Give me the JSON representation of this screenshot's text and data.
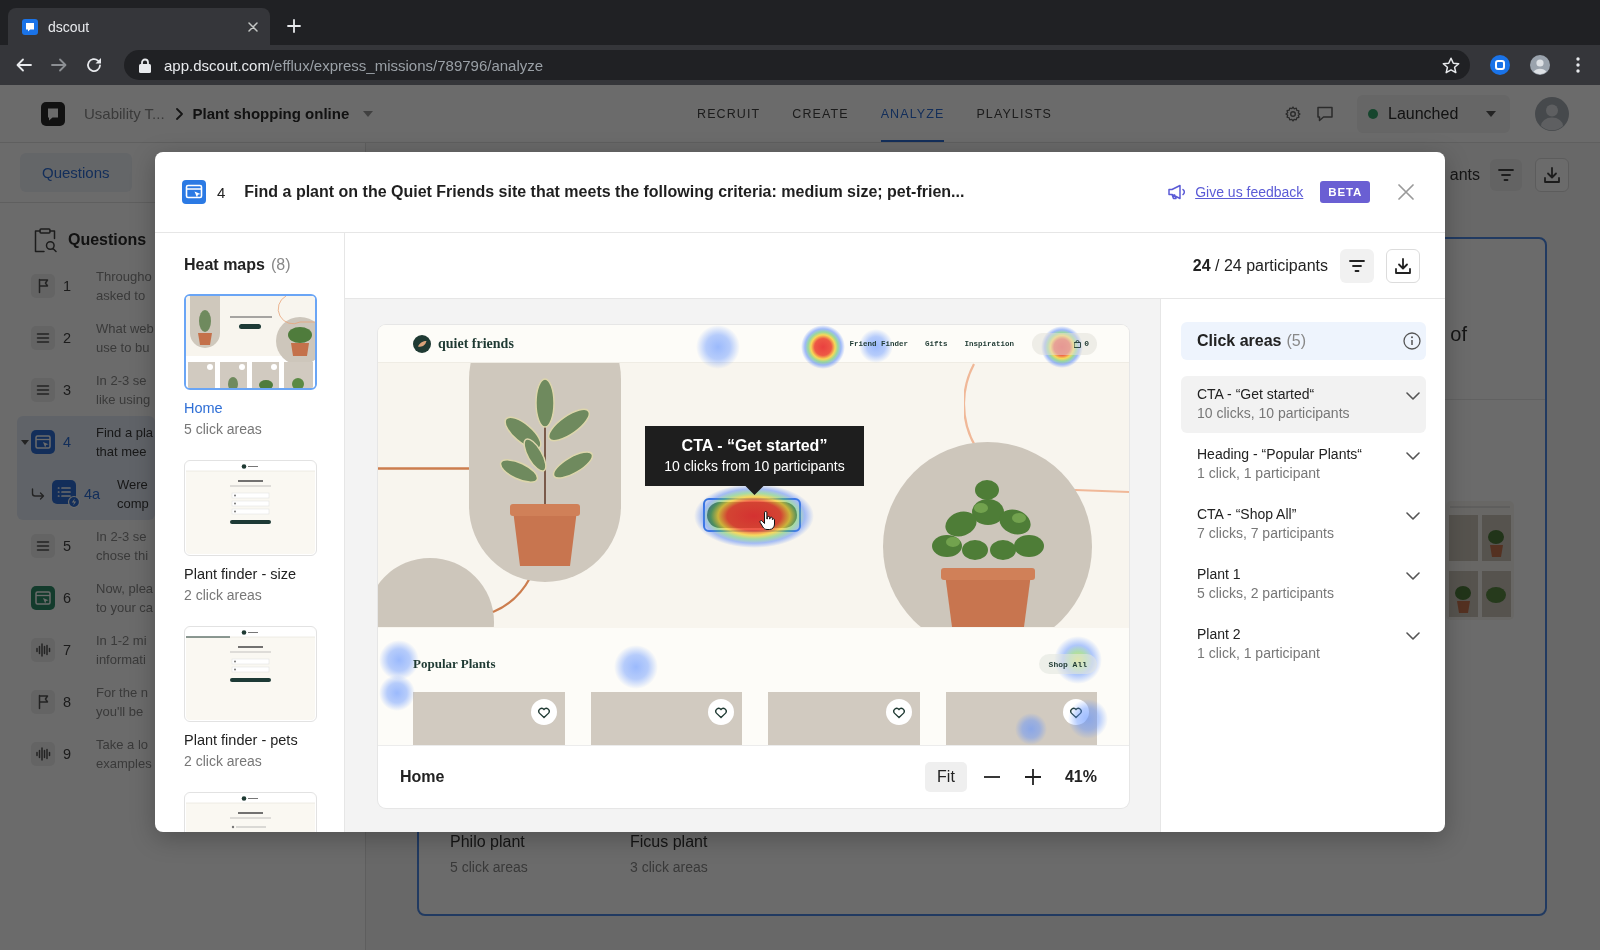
{
  "browser": {
    "tab": {
      "title": "dscout"
    },
    "url": {
      "host": "app.dscout.com",
      "path": "/efflux/express_missions/789796/analyze"
    }
  },
  "header": {
    "breadcrumb": {
      "parent": "Usability T...",
      "current": "Plant shopping online"
    },
    "nav": [
      {
        "label": "RECRUIT",
        "selected": false
      },
      {
        "label": "CREATE",
        "selected": false
      },
      {
        "label": "ANALYZE",
        "selected": true
      },
      {
        "label": "PLAYLISTS",
        "selected": false
      }
    ],
    "status": {
      "label": "Launched"
    }
  },
  "sidebar": {
    "tabs": [
      {
        "label": "Questions",
        "selected": true
      }
    ],
    "heading": "Questions",
    "questions": [
      {
        "kind": "flag",
        "number": "1",
        "lines": [
          "Througho",
          "asked to"
        ],
        "selected": false
      },
      {
        "kind": "text",
        "number": "2",
        "lines": [
          "What web",
          "use to bu"
        ],
        "selected": false
      },
      {
        "kind": "text",
        "number": "3",
        "lines": [
          "In 2-3 se",
          "like using"
        ],
        "selected": false
      },
      {
        "kind": "screen",
        "number": "4",
        "lines": [
          "Find a pla",
          "that mee"
        ],
        "selected": true,
        "expanded": true,
        "children": [
          {
            "kind": "list",
            "number": "4a",
            "lines": [
              "Were",
              "comp"
            ],
            "selected": true
          }
        ]
      },
      {
        "kind": "text",
        "number": "5",
        "lines": [
          "In 2-3 se",
          "chose thi"
        ],
        "selected": false
      },
      {
        "kind": "screen",
        "number": "6",
        "lines": [
          "Now, plea",
          "to your ca"
        ],
        "selected": false
      },
      {
        "kind": "audio",
        "number": "7",
        "lines": [
          "In 1-2 mi",
          "informati"
        ],
        "selected": false
      },
      {
        "kind": "flag",
        "number": "8",
        "lines": [
          "For the n",
          "you'll be"
        ],
        "selected": false
      },
      {
        "kind": "audio",
        "number": "9",
        "lines": [
          "Take a lo",
          "examples"
        ],
        "selected": false
      }
    ]
  },
  "main": {
    "participants": "ants",
    "card": {
      "text": "of",
      "heat_maps": [
        {
          "label": "Philo plant",
          "meta": "5 click areas"
        },
        {
          "label": "Ficus plant",
          "meta": "3 click areas"
        }
      ]
    }
  },
  "modal": {
    "question": {
      "number": "4",
      "title": "Find a plant on the Quiet Friends site that meets the following criteria: medium size; pet-frien..."
    },
    "feedback_link": "Give us feedback",
    "badge": "BETA",
    "heat_maps": {
      "title": "Heat maps",
      "count": "(8)",
      "items": [
        {
          "kind": "home",
          "label": "Home",
          "meta": "5 click areas",
          "selected": true
        },
        {
          "kind": "sizes",
          "label": "Plant finder - size",
          "meta": "2 click areas",
          "selected": false
        },
        {
          "kind": "pets",
          "label": "Plant finder - pets",
          "meta": "2 click areas",
          "selected": false
        },
        {
          "kind": "questions",
          "selected": false
        }
      ]
    },
    "participants": "**24** / 24 participants",
    "preview": {
      "page": {
        "brand": "quiet friends",
        "nav": [
          "Friend Finder",
          "Gifts",
          "Inspiration"
        ],
        "cart_count": "0",
        "section_title": "Popular Plants",
        "shop_all": "Shop All",
        "products": [
          {
            "favorited": false
          },
          {
            "favorited": false
          },
          {
            "favorited": false
          },
          {
            "favorited": false
          }
        ]
      },
      "tooltip": {
        "title": "CTA - “Get started”",
        "detail": "10 clicks from 10 participants"
      },
      "footer": {
        "page_name": "Home",
        "fit": "Fit",
        "zoom": "41%"
      }
    },
    "click_areas": {
      "title": "Click areas",
      "count": "(5)",
      "items": [
        {
          "title": "CTA - “Get started“",
          "stats": "10 clicks, 10 participants",
          "selected": true
        },
        {
          "title": "Heading - “Popular Plants“",
          "stats": "1 click, 1 participant",
          "selected": false
        },
        {
          "title": "CTA - “Shop All”",
          "stats": "7 clicks, 7 participants",
          "selected": false
        },
        {
          "title": "Plant 1",
          "stats": "5 clicks, 2 participants",
          "selected": false
        },
        {
          "title": "Plant 2",
          "stats": "1 click, 1 participant",
          "selected": false
        }
      ]
    }
  }
}
